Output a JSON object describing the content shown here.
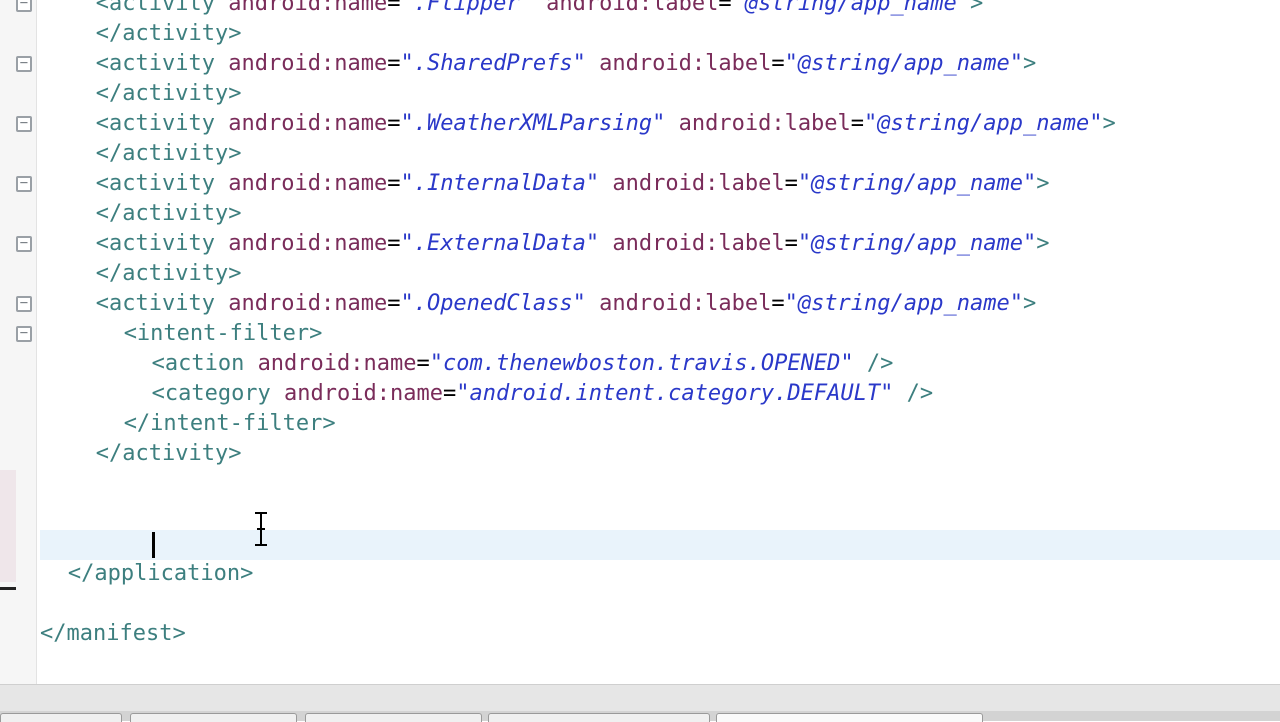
{
  "lines": [
    {
      "indent": 4,
      "parts": [
        [
          "tag",
          "<activity "
        ],
        [
          "attr",
          "android:name"
        ],
        [
          "eq",
          "="
        ],
        [
          "str",
          "\".Flipper\""
        ],
        [
          "tag",
          " "
        ],
        [
          "attr",
          "android:label"
        ],
        [
          "eq",
          "="
        ],
        [
          "str",
          "\"@string/app_name\""
        ],
        [
          "tag",
          ">"
        ]
      ]
    },
    {
      "indent": 4,
      "parts": [
        [
          "tag",
          "</activity>"
        ]
      ]
    },
    {
      "indent": 4,
      "parts": [
        [
          "tag",
          "<activity "
        ],
        [
          "attr",
          "android:name"
        ],
        [
          "eq",
          "="
        ],
        [
          "str",
          "\".SharedPrefs\""
        ],
        [
          "tag",
          " "
        ],
        [
          "attr",
          "android:label"
        ],
        [
          "eq",
          "="
        ],
        [
          "str",
          "\"@string/app_name\""
        ],
        [
          "tag",
          ">"
        ]
      ]
    },
    {
      "indent": 4,
      "parts": [
        [
          "tag",
          "</activity>"
        ]
      ]
    },
    {
      "indent": 4,
      "parts": [
        [
          "tag",
          "<activity "
        ],
        [
          "attr",
          "android:name"
        ],
        [
          "eq",
          "="
        ],
        [
          "str",
          "\".WeatherXMLParsing\""
        ],
        [
          "tag",
          " "
        ],
        [
          "attr",
          "android:label"
        ],
        [
          "eq",
          "="
        ],
        [
          "str",
          "\"@string/app_name\""
        ],
        [
          "tag",
          ">"
        ]
      ]
    },
    {
      "indent": 4,
      "parts": [
        [
          "tag",
          "</activity>"
        ]
      ]
    },
    {
      "indent": 4,
      "parts": [
        [
          "tag",
          "<activity "
        ],
        [
          "attr",
          "android:name"
        ],
        [
          "eq",
          "="
        ],
        [
          "str",
          "\".InternalData\""
        ],
        [
          "tag",
          " "
        ],
        [
          "attr",
          "android:label"
        ],
        [
          "eq",
          "="
        ],
        [
          "str",
          "\"@string/app_name\""
        ],
        [
          "tag",
          ">"
        ]
      ]
    },
    {
      "indent": 4,
      "parts": [
        [
          "tag",
          "</activity>"
        ]
      ]
    },
    {
      "indent": 4,
      "parts": [
        [
          "tag",
          "<activity "
        ],
        [
          "attr",
          "android:name"
        ],
        [
          "eq",
          "="
        ],
        [
          "str",
          "\".ExternalData\""
        ],
        [
          "tag",
          " "
        ],
        [
          "attr",
          "android:label"
        ],
        [
          "eq",
          "="
        ],
        [
          "str",
          "\"@string/app_name\""
        ],
        [
          "tag",
          ">"
        ]
      ]
    },
    {
      "indent": 4,
      "parts": [
        [
          "tag",
          "</activity>"
        ]
      ]
    },
    {
      "indent": 4,
      "parts": [
        [
          "tag",
          "<activity "
        ],
        [
          "attr",
          "android:name"
        ],
        [
          "eq",
          "="
        ],
        [
          "str",
          "\".OpenedClass\""
        ],
        [
          "tag",
          " "
        ],
        [
          "attr",
          "android:label"
        ],
        [
          "eq",
          "="
        ],
        [
          "str",
          "\"@string/app_name\""
        ],
        [
          "tag",
          ">"
        ]
      ]
    },
    {
      "indent": 6,
      "parts": [
        [
          "tag",
          "<intent-filter>"
        ]
      ]
    },
    {
      "indent": 8,
      "parts": [
        [
          "tag",
          "<action "
        ],
        [
          "attr",
          "android:name"
        ],
        [
          "eq",
          "="
        ],
        [
          "str",
          "\"com.thenewboston.travis.OPENED\""
        ],
        [
          "tag",
          " />"
        ]
      ]
    },
    {
      "indent": 8,
      "parts": [
        [
          "tag",
          "<category "
        ],
        [
          "attr",
          "android:name"
        ],
        [
          "eq",
          "="
        ],
        [
          "str",
          "\"android.intent.category.DEFAULT\""
        ],
        [
          "tag",
          " />"
        ]
      ]
    },
    {
      "indent": 6,
      "parts": [
        [
          "tag",
          "</intent-filter>"
        ]
      ]
    },
    {
      "indent": 4,
      "parts": [
        [
          "tag",
          "</activity>"
        ]
      ]
    },
    {
      "indent": 0,
      "parts": []
    },
    {
      "indent": 4,
      "parts": []
    },
    {
      "indent": 0,
      "parts": []
    },
    {
      "indent": 2,
      "parts": [
        [
          "tag",
          "</application>"
        ]
      ]
    },
    {
      "indent": 0,
      "parts": []
    },
    {
      "indent": 0,
      "parts": [
        [
          "tag",
          "</manifest>"
        ]
      ]
    }
  ],
  "fold_rows": [
    0,
    2,
    4,
    6,
    8,
    10,
    11
  ],
  "current_line": 18,
  "colors": {
    "tag": "#3d7f7f",
    "attr": "#7a2c5a",
    "string": "#2a38c9",
    "current_line_bg": "#e9f3fb"
  }
}
